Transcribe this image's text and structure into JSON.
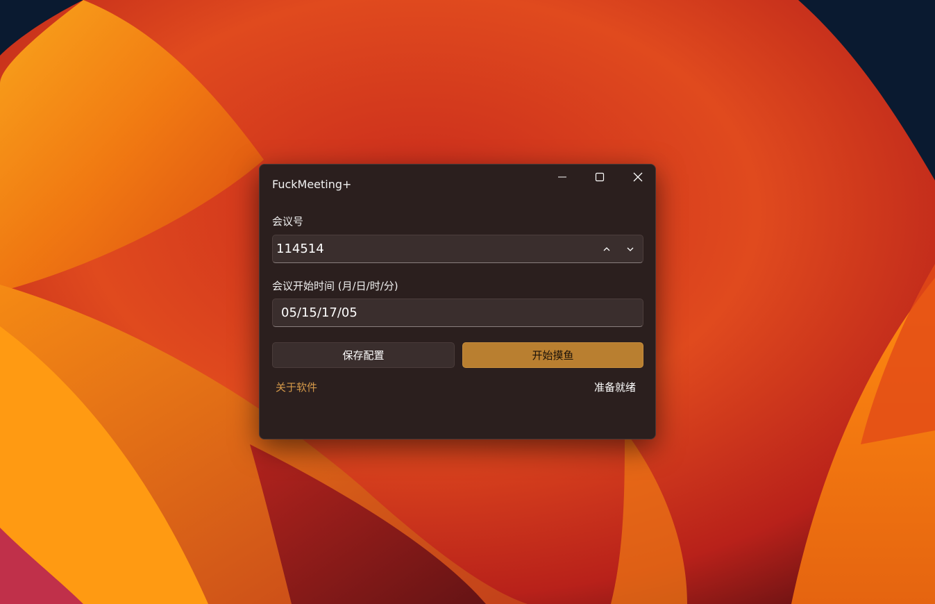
{
  "window": {
    "title": "FuckMeeting+"
  },
  "form": {
    "meeting_id_label": "会议号",
    "meeting_id_value": "114514",
    "start_time_label": "会议开始时间 (月/日/时/分)",
    "start_time_value": "05/15/17/05"
  },
  "actions": {
    "save_label": "保存配置",
    "start_label": "开始摸鱼"
  },
  "footer": {
    "about_label": "关于软件",
    "status_text": "准备就绪"
  },
  "icons": {
    "minimize": "minimize-icon",
    "maximize": "maximize-icon",
    "close": "close-icon",
    "spin_up": "chevron-up-icon",
    "spin_down": "chevron-down-icon"
  },
  "colors": {
    "accent": "#b97f30",
    "link": "#d69a4a",
    "window_bg": "#2b1f1e"
  }
}
